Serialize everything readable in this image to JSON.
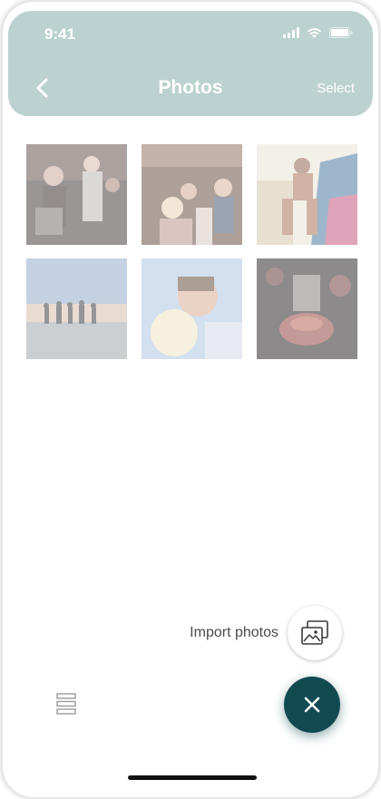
{
  "status_bar": {
    "time": "9:41"
  },
  "header": {
    "title": "Photos",
    "select_label": "Select"
  },
  "photos": [
    {
      "name": "photo-crowd-party"
    },
    {
      "name": "photo-friends-celebration"
    },
    {
      "name": "photo-dancer"
    },
    {
      "name": "photo-beach-silhouettes"
    },
    {
      "name": "photo-couple-kiss"
    },
    {
      "name": "photo-drink-glass"
    }
  ],
  "import": {
    "label": "Import photos"
  },
  "colors": {
    "header_bg": "#b7cfcc",
    "fab_bg": "#124a52"
  }
}
